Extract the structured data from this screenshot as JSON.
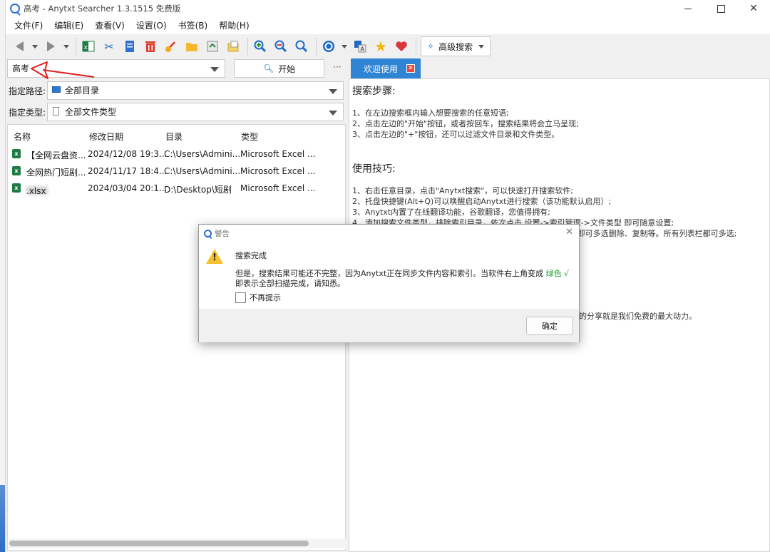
{
  "window": {
    "title": "高考 - Anytxt Searcher 1.3.1515 免费版"
  },
  "menu": [
    "文件(F)",
    "编辑(E)",
    "查看(V)",
    "设置(O)",
    "书签(B)",
    "帮助(H)"
  ],
  "toolbar": {
    "advanced_search_label": "高级搜索"
  },
  "search": {
    "query": "高考",
    "start_label": "开始",
    "more_label": "···"
  },
  "filters": {
    "path_label": "指定路径:",
    "path_value": "全部目录",
    "type_label": "指定类型:",
    "type_value": "全部文件类型"
  },
  "results": {
    "columns": [
      "名称",
      "修改日期",
      "目录",
      "类型"
    ],
    "rows": [
      {
        "name": "【全网云盘资...",
        "date": "2024/12/08 19:3...",
        "dir": "C:\\Users\\Admini...",
        "type": "Microsoft Excel ..."
      },
      {
        "name": "全网热门短剧...",
        "date": "2024/11/17 18:4...",
        "dir": "C:\\Users\\Admini...",
        "type": "Microsoft Excel ..."
      },
      {
        "name": ".xlsx",
        "date": "2024/03/04 20:1...",
        "dir": "D:\\Desktop\\短剧",
        "type": "Microsoft Excel ..."
      }
    ]
  },
  "tab": {
    "label": "欢迎使用"
  },
  "welcome": {
    "steps_title": "搜索步骤:",
    "steps": [
      "1、在左边搜索框内输入想要搜索的任意短语;",
      "2、点击左边的\"开始\"按钮，或者按回车，搜索结果将会立马呈现;",
      "3、点击左边的\"+\"按钮，还可以过滤文件目录和文件类型。"
    ],
    "tips_title": "使用技巧:",
    "tips": [
      "1、右击任意目录，点击\"Anytxt搜索\"，可以快速打开搜索软件;",
      "2、托盘快捷键(Alt+Q)可以唤醒启动Anytxt进行搜索（该功能默认启用）;",
      "3、Anytxt内置了在线翻译功能，谷歌翻译，您值得拥有;",
      "4、添加搜索文件类型，排除索引目录，依次点击 设置->索引管理->文件类型 即可随意设置;",
      "5、多选搜索结果列表，按住Ctrl或Shift键，然后鼠标依次点击列即可多选删除、复制等。所有列表栏都可多选;"
    ],
    "partial_line": "的分享就是我们免费的最大动力。"
  },
  "dialog": {
    "title": "警告",
    "heading": "搜索完成",
    "message_pre": "但是，搜索结果可能还不完整，因为Anytxt正在同步文件内容和索引。当软件右上角变成",
    "message_green": "绿色 √",
    "message_post": "即表示全部扫描完成，请知悉。",
    "checkbox_label": "不再提示",
    "ok_label": "确定"
  },
  "colors": {
    "accent": "#2f84d4",
    "annotation": "#e02020",
    "success": "#1e9a2e",
    "warning": "#f6c12e"
  }
}
